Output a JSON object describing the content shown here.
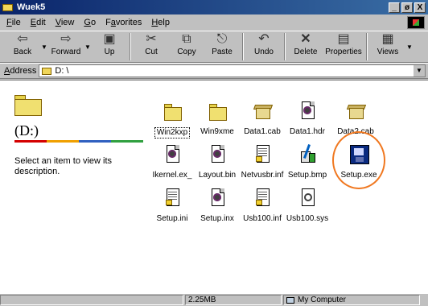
{
  "window": {
    "title": "Wuek5",
    "title_buttons": [
      "_",
      "ø",
      "X"
    ]
  },
  "menu": [
    {
      "u": "F",
      "rest": "ile"
    },
    {
      "u": "E",
      "rest": "dit"
    },
    {
      "u": "V",
      "rest": "iew"
    },
    {
      "u": "G",
      "rest": "o"
    },
    {
      "pre": "F",
      "u": "a",
      "rest": "vorites"
    },
    {
      "u": "H",
      "rest": "elp"
    }
  ],
  "menu_labels": [
    "File",
    "Edit",
    "View",
    "Go",
    "Favorites",
    "Help"
  ],
  "toolbar": {
    "back": "Back",
    "forward": "Forward",
    "up": "Up",
    "cut": "Cut",
    "copy": "Copy",
    "paste": "Paste",
    "undo": "Undo",
    "delete": "Delete",
    "properties": "Properties",
    "views": "Views"
  },
  "address": {
    "label_u": "A",
    "label_rest": "ddress",
    "value": "D: \\"
  },
  "left_pane": {
    "drive_title": "(D:)",
    "description": "Select an item to view its description."
  },
  "files": [
    {
      "name": "Win2kxp",
      "icon": "folder-icon",
      "selected": true
    },
    {
      "name": "Win9xme",
      "icon": "folder-icon"
    },
    {
      "name": "Data1.cab",
      "icon": "cabinet-icon"
    },
    {
      "name": "Data1.hdr",
      "icon": "doc-icon"
    },
    {
      "name": "Data2.cab",
      "icon": "cabinet-icon"
    },
    {
      "name": "Ikernel.ex_",
      "icon": "doc-icon"
    },
    {
      "name": "Layout.bin",
      "icon": "doc-icon"
    },
    {
      "name": "Netvusbr.inf",
      "icon": "text-doc-icon"
    },
    {
      "name": "Setup.bmp",
      "icon": "paint-icon"
    },
    {
      "name": "Setup.exe",
      "icon": "setup-exe-icon",
      "highlighted": true
    },
    {
      "name": "Setup.ini",
      "icon": "text-doc-icon"
    },
    {
      "name": "Setup.inx",
      "icon": "doc-icon"
    },
    {
      "name": "Usb100.inf",
      "icon": "text-doc-icon"
    },
    {
      "name": "Usb100.sys",
      "icon": "system-file-icon"
    }
  ],
  "status": {
    "size": "2.25MB",
    "location": "My Computer"
  },
  "colors": {
    "highlight_circle": "#f07820",
    "title_bar": "#0a246a"
  }
}
